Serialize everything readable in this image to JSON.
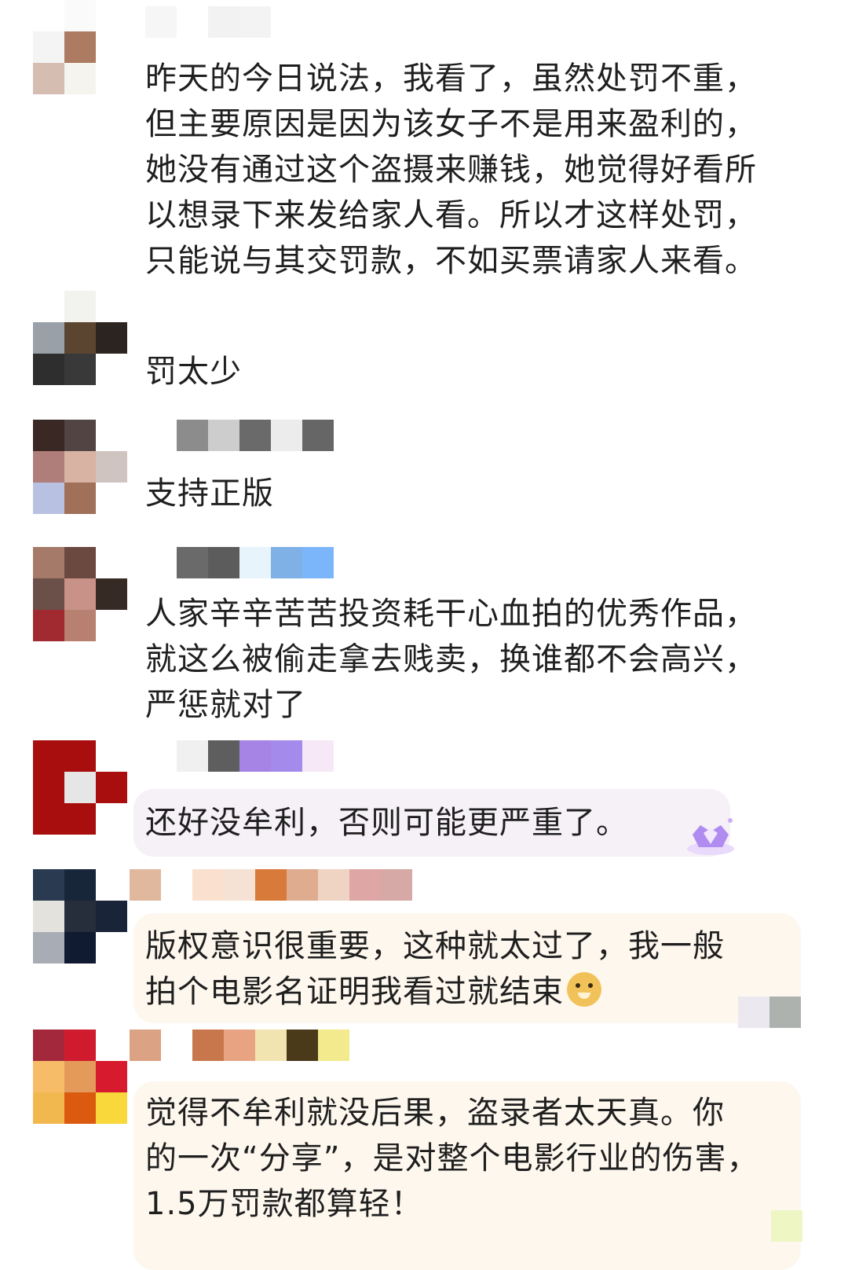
{
  "comments": [
    {
      "id": "c1",
      "text": "昨天的今日说法，我看了，虽然处罚不重，\n但主要原因是因为该女子不是用来盈利的，\n她没有通过这个盗摄来赚钱，她觉得好看所\n以想录下来发给家人看。所以才这样处罚，\n只能说与其交罚款，不如买票请家人来看。"
    },
    {
      "id": "c2",
      "text": "罚太少"
    },
    {
      "id": "c3",
      "text": "支持正版"
    },
    {
      "id": "c4",
      "text": "人家辛辛苦苦投资耗干心血拍的优秀作品，\n就这么被偷走拿去贱卖，换谁都不会高兴，\n严惩就对了"
    },
    {
      "id": "c5",
      "text": "还好没牟利，否则可能更严重了。"
    },
    {
      "id": "c6",
      "text": "版权意识很重要，这种就太过了，我一般\n拍个电影名证明我看过就结束"
    },
    {
      "id": "c7",
      "text": "觉得不牟利就没后果，盗录者太天真。你\n的一次“分享”，是对整个电影行业的伤害，\n1.5万罚款都算轻！"
    }
  ],
  "icons": {
    "doge": "doge-emoji-icon",
    "badge": "purple-crown-badge-icon"
  },
  "colors": {
    "text": "#1f1f1f",
    "bubble_pink": "#f6f0f7",
    "bubble_cream": "#fdf7ee"
  }
}
